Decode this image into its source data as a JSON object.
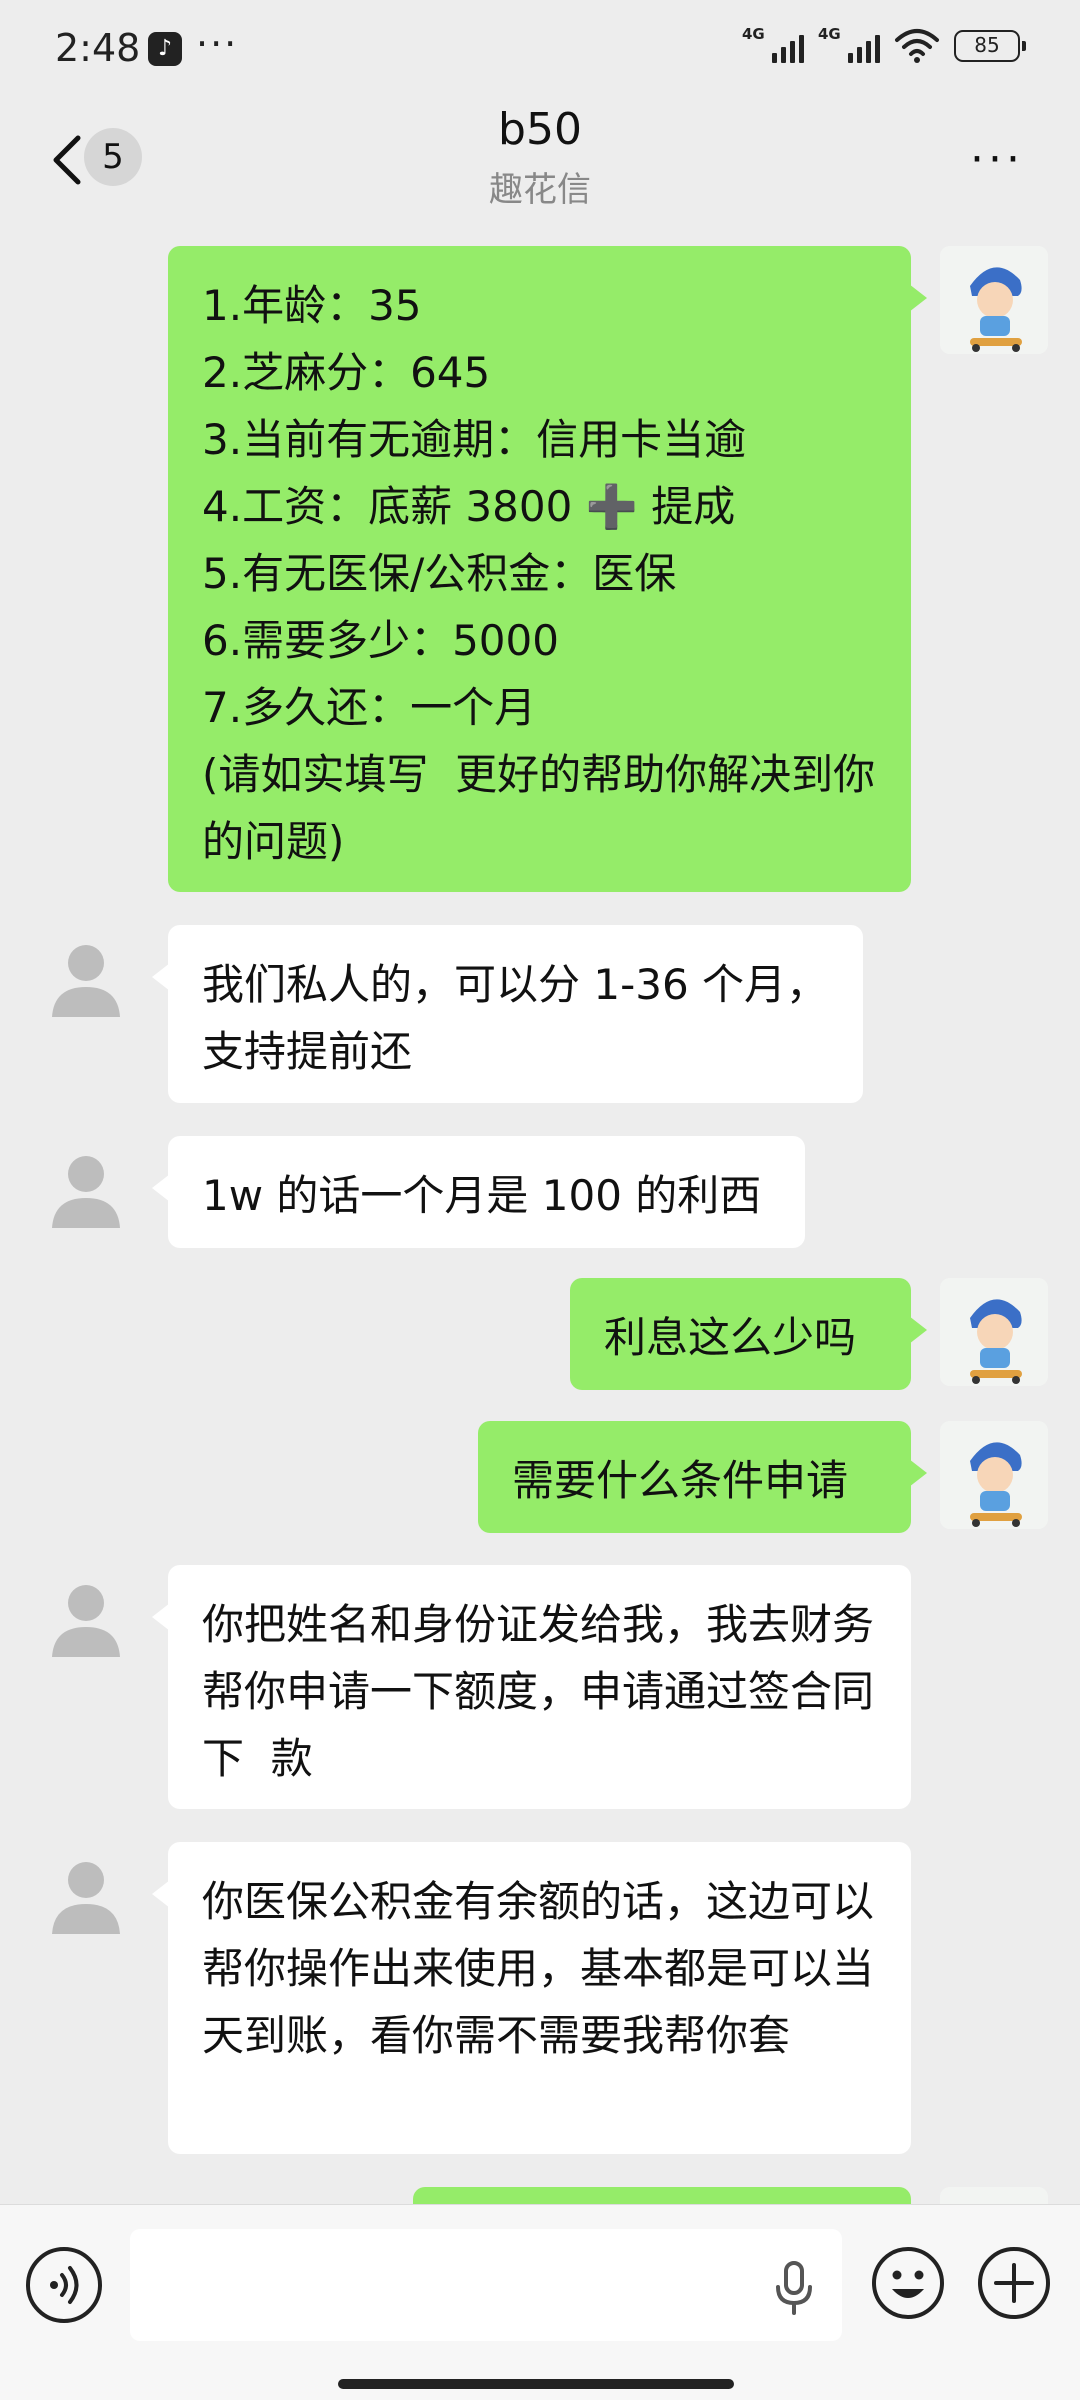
{
  "status_bar": {
    "time": "2:48",
    "more": "···",
    "signal1": "4G",
    "signal2": "4G",
    "battery": "85"
  },
  "header": {
    "unread_count": "5",
    "title": "b50",
    "subtitle": "趣花信",
    "more": "···"
  },
  "messages": [
    {
      "side": "out",
      "text": "1.年龄：35\n2.芝麻分：645\n3.当前有无逾期：信用卡当逾\n4.工资：底薪 3800 ➕ 提成\n5.有无医保/公积金：医保\n6.需要多少：5000\n7.多久还：一个月\n(请如实填写  更好的帮助你解决到你的问题)"
    },
    {
      "side": "in",
      "text": "我们私人的，可以分 1-36 个月，支持提前还"
    },
    {
      "side": "in",
      "text": "1w 的话一个月是 100 的利西"
    },
    {
      "side": "out",
      "text": "利息这么少吗"
    },
    {
      "side": "out",
      "text": "需要什么条件申请"
    },
    {
      "side": "in",
      "text": "你把姓名和身份证发给我，我去财务帮你申请一下额度，申请通过签合同  下  款"
    },
    {
      "side": "in",
      "text": "你医保公积金有余额的话，这边可以帮你操作出来使用，基本都是可以当天到账，看你需不需要我帮你套"
    },
    {
      "side": "out",
      "text": ""
    }
  ],
  "input": {
    "value": "",
    "placeholder": ""
  },
  "icons": {
    "back": "chevron-left-icon",
    "voice": "voice-icon",
    "mic": "microphone-icon",
    "emoji": "emoji-icon",
    "plus": "plus-icon"
  },
  "colors": {
    "outgoing_bubble": "#95ec69",
    "incoming_bubble": "#ffffff",
    "background": "#ededed"
  }
}
